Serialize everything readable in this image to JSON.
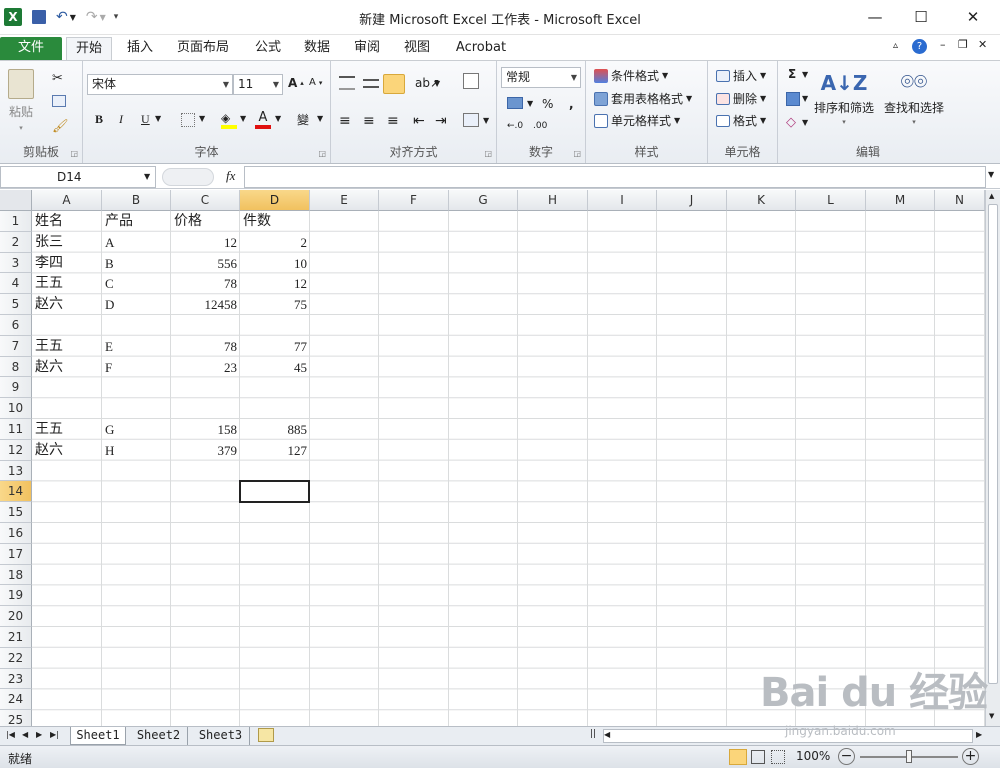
{
  "window": {
    "title": "新建 Microsoft Excel 工作表 - Microsoft Excel"
  },
  "tabs": [
    "文件",
    "开始",
    "插入",
    "页面布局",
    "公式",
    "数据",
    "审阅",
    "视图",
    "Acrobat"
  ],
  "ribbon": {
    "clipboard": {
      "paste": "粘贴",
      "label": "剪贴板"
    },
    "font": {
      "name": "宋体",
      "size": "11",
      "label": "字体",
      "bold": "B",
      "italic": "I",
      "underline": "U"
    },
    "align": {
      "label": "对齐方式"
    },
    "number": {
      "format": "常规",
      "label": "数字",
      "percent": "%"
    },
    "styles": {
      "cond": "条件格式",
      "table": "套用表格格式",
      "cell": "单元格样式",
      "label": "样式"
    },
    "cells": {
      "insert": "插入",
      "delete": "删除",
      "format": "格式",
      "label": "单元格"
    },
    "editing": {
      "sort": "排序和筛选",
      "find": "查找和选择",
      "label": "编辑",
      "sigma": "Σ"
    }
  },
  "formula_bar": {
    "name_box": "D14",
    "fx": "fx",
    "value": ""
  },
  "grid": {
    "columns": [
      "A",
      "B",
      "C",
      "D",
      "E",
      "F",
      "G",
      "H",
      "I",
      "J",
      "K",
      "L",
      "M",
      "N"
    ],
    "rows": [
      "1",
      "2",
      "3",
      "4",
      "5",
      "6",
      "7",
      "8",
      "9",
      "10",
      "11",
      "12",
      "13",
      "14",
      "15",
      "16",
      "17",
      "18",
      "19",
      "20",
      "21",
      "22",
      "23",
      "24",
      "25"
    ],
    "selected_cell": "D14",
    "cells": [
      {
        "r": 1,
        "c": "A",
        "v": "姓名"
      },
      {
        "r": 1,
        "c": "B",
        "v": "产品"
      },
      {
        "r": 1,
        "c": "C",
        "v": "价格"
      },
      {
        "r": 1,
        "c": "D",
        "v": "件数"
      },
      {
        "r": 2,
        "c": "A",
        "v": "张三"
      },
      {
        "r": 2,
        "c": "B",
        "v": "A"
      },
      {
        "r": 2,
        "c": "C",
        "v": "12"
      },
      {
        "r": 2,
        "c": "D",
        "v": "2"
      },
      {
        "r": 3,
        "c": "A",
        "v": "李四"
      },
      {
        "r": 3,
        "c": "B",
        "v": "B"
      },
      {
        "r": 3,
        "c": "C",
        "v": "556"
      },
      {
        "r": 3,
        "c": "D",
        "v": "10"
      },
      {
        "r": 4,
        "c": "A",
        "v": "王五"
      },
      {
        "r": 4,
        "c": "B",
        "v": "C"
      },
      {
        "r": 4,
        "c": "C",
        "v": "78"
      },
      {
        "r": 4,
        "c": "D",
        "v": "12"
      },
      {
        "r": 5,
        "c": "A",
        "v": "赵六"
      },
      {
        "r": 5,
        "c": "B",
        "v": "D"
      },
      {
        "r": 5,
        "c": "C",
        "v": "12458"
      },
      {
        "r": 5,
        "c": "D",
        "v": "75"
      },
      {
        "r": 7,
        "c": "A",
        "v": "王五"
      },
      {
        "r": 7,
        "c": "B",
        "v": "E"
      },
      {
        "r": 7,
        "c": "C",
        "v": "78"
      },
      {
        "r": 7,
        "c": "D",
        "v": "77"
      },
      {
        "r": 8,
        "c": "A",
        "v": "赵六"
      },
      {
        "r": 8,
        "c": "B",
        "v": "F"
      },
      {
        "r": 8,
        "c": "C",
        "v": "23"
      },
      {
        "r": 8,
        "c": "D",
        "v": "45"
      },
      {
        "r": 11,
        "c": "A",
        "v": "王五"
      },
      {
        "r": 11,
        "c": "B",
        "v": "G"
      },
      {
        "r": 11,
        "c": "C",
        "v": "158"
      },
      {
        "r": 11,
        "c": "D",
        "v": "885"
      },
      {
        "r": 12,
        "c": "A",
        "v": "赵六"
      },
      {
        "r": 12,
        "c": "B",
        "v": "H"
      },
      {
        "r": 12,
        "c": "C",
        "v": "379"
      },
      {
        "r": 12,
        "c": "D",
        "v": "127"
      }
    ]
  },
  "sheets": [
    "Sheet1",
    "Sheet2",
    "Sheet3"
  ],
  "status": {
    "ready": "就绪",
    "zoom": "100%"
  },
  "watermark": {
    "text": "Bai du 经验",
    "url": "jingyan.baidu.com"
  }
}
